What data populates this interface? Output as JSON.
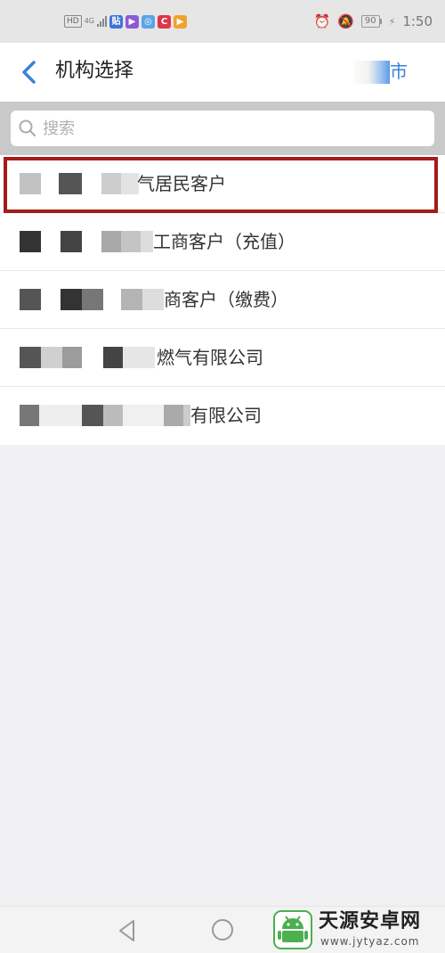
{
  "status_bar": {
    "hd_badge": "HD",
    "network_label": "4G",
    "battery_level": "90",
    "time": "1:50",
    "app_icons": [
      "app-icon-1",
      "app-icon-2",
      "app-icon-3",
      "app-icon-4",
      "app-icon-5"
    ],
    "icons": [
      "alarm-icon",
      "bell-off-icon",
      "charging-icon"
    ]
  },
  "header": {
    "title": "机构选择",
    "city_suffix": "市"
  },
  "search": {
    "placeholder": "搜索",
    "value": ""
  },
  "organizations": [
    {
      "label": "气居民客户",
      "selected": true
    },
    {
      "label": "工商客户（充值）",
      "selected": false
    },
    {
      "label": "商客户（缴费）",
      "selected": false
    },
    {
      "label": "燃气有限公司",
      "selected": false
    },
    {
      "label": "有限公司",
      "selected": false
    }
  ],
  "nav_bar": {
    "icons": [
      "nav-back-icon",
      "nav-home-icon"
    ]
  },
  "watermark": {
    "title": "天源安卓网",
    "url": "www.jytyaz.com"
  },
  "colors": {
    "accent_blue": "#3b82d6",
    "highlight_red": "#a51b1b"
  }
}
